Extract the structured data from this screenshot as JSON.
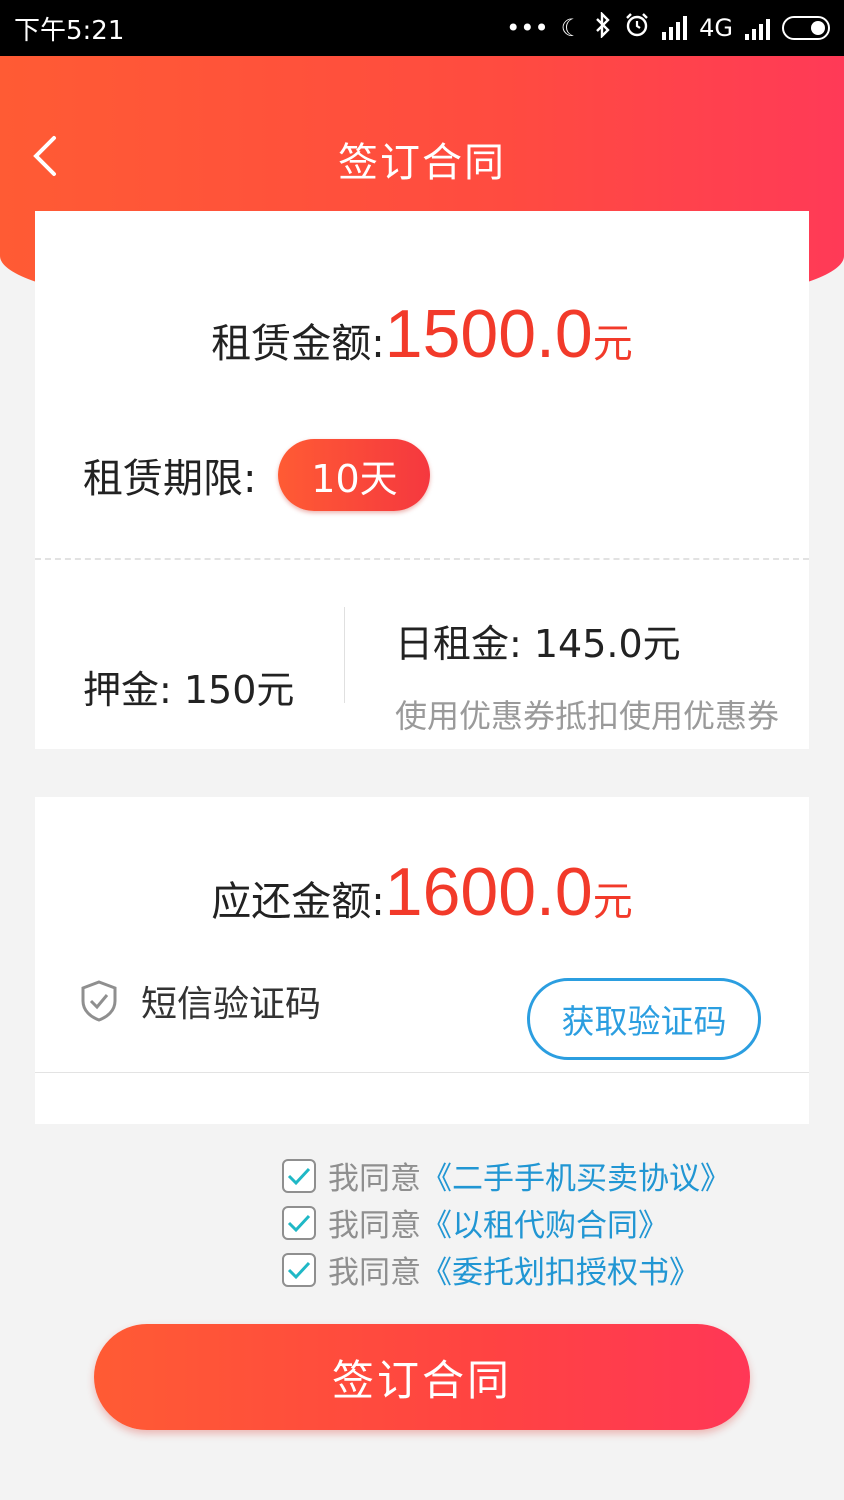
{
  "status_bar": {
    "time": "下午5:21",
    "network": "4G",
    "icons": [
      "dots-icon",
      "moon-icon",
      "bluetooth-icon",
      "alarm-icon",
      "hd-signal-icon",
      "signal-icon",
      "battery-icon"
    ]
  },
  "header": {
    "title": "签订合同",
    "back_icon": "chevron-left-icon"
  },
  "lease": {
    "amount_label": "租赁金额:",
    "amount_value": "1500.0",
    "amount_unit": "元",
    "term_label": "租赁期限:",
    "term_value": "10天",
    "deposit": "押金: 150元",
    "daily_rent": "日租金: 145.0元",
    "coupon_text": "使用优惠券抵扣使用优惠券"
  },
  "repay": {
    "amount_label": "应还金额:",
    "amount_value": "1600.0",
    "amount_unit": "元",
    "sms_label": "短信验证码",
    "sms_placeholder": "",
    "get_code_label": "获取验证码"
  },
  "agreements": [
    {
      "prefix": "我同意",
      "link": "《二手手机买卖协议》",
      "checked": true
    },
    {
      "prefix": "我同意",
      "link": "《以租代购合同》",
      "checked": true
    },
    {
      "prefix": "我同意",
      "link": "《委托划扣授权书》",
      "checked": true
    }
  ],
  "submit_label": "签订合同",
  "colors": {
    "accent": "#ff4b40",
    "amount_red": "#f23a2a",
    "link_blue": "#2196d3",
    "check_teal": "#1fb8c6"
  }
}
